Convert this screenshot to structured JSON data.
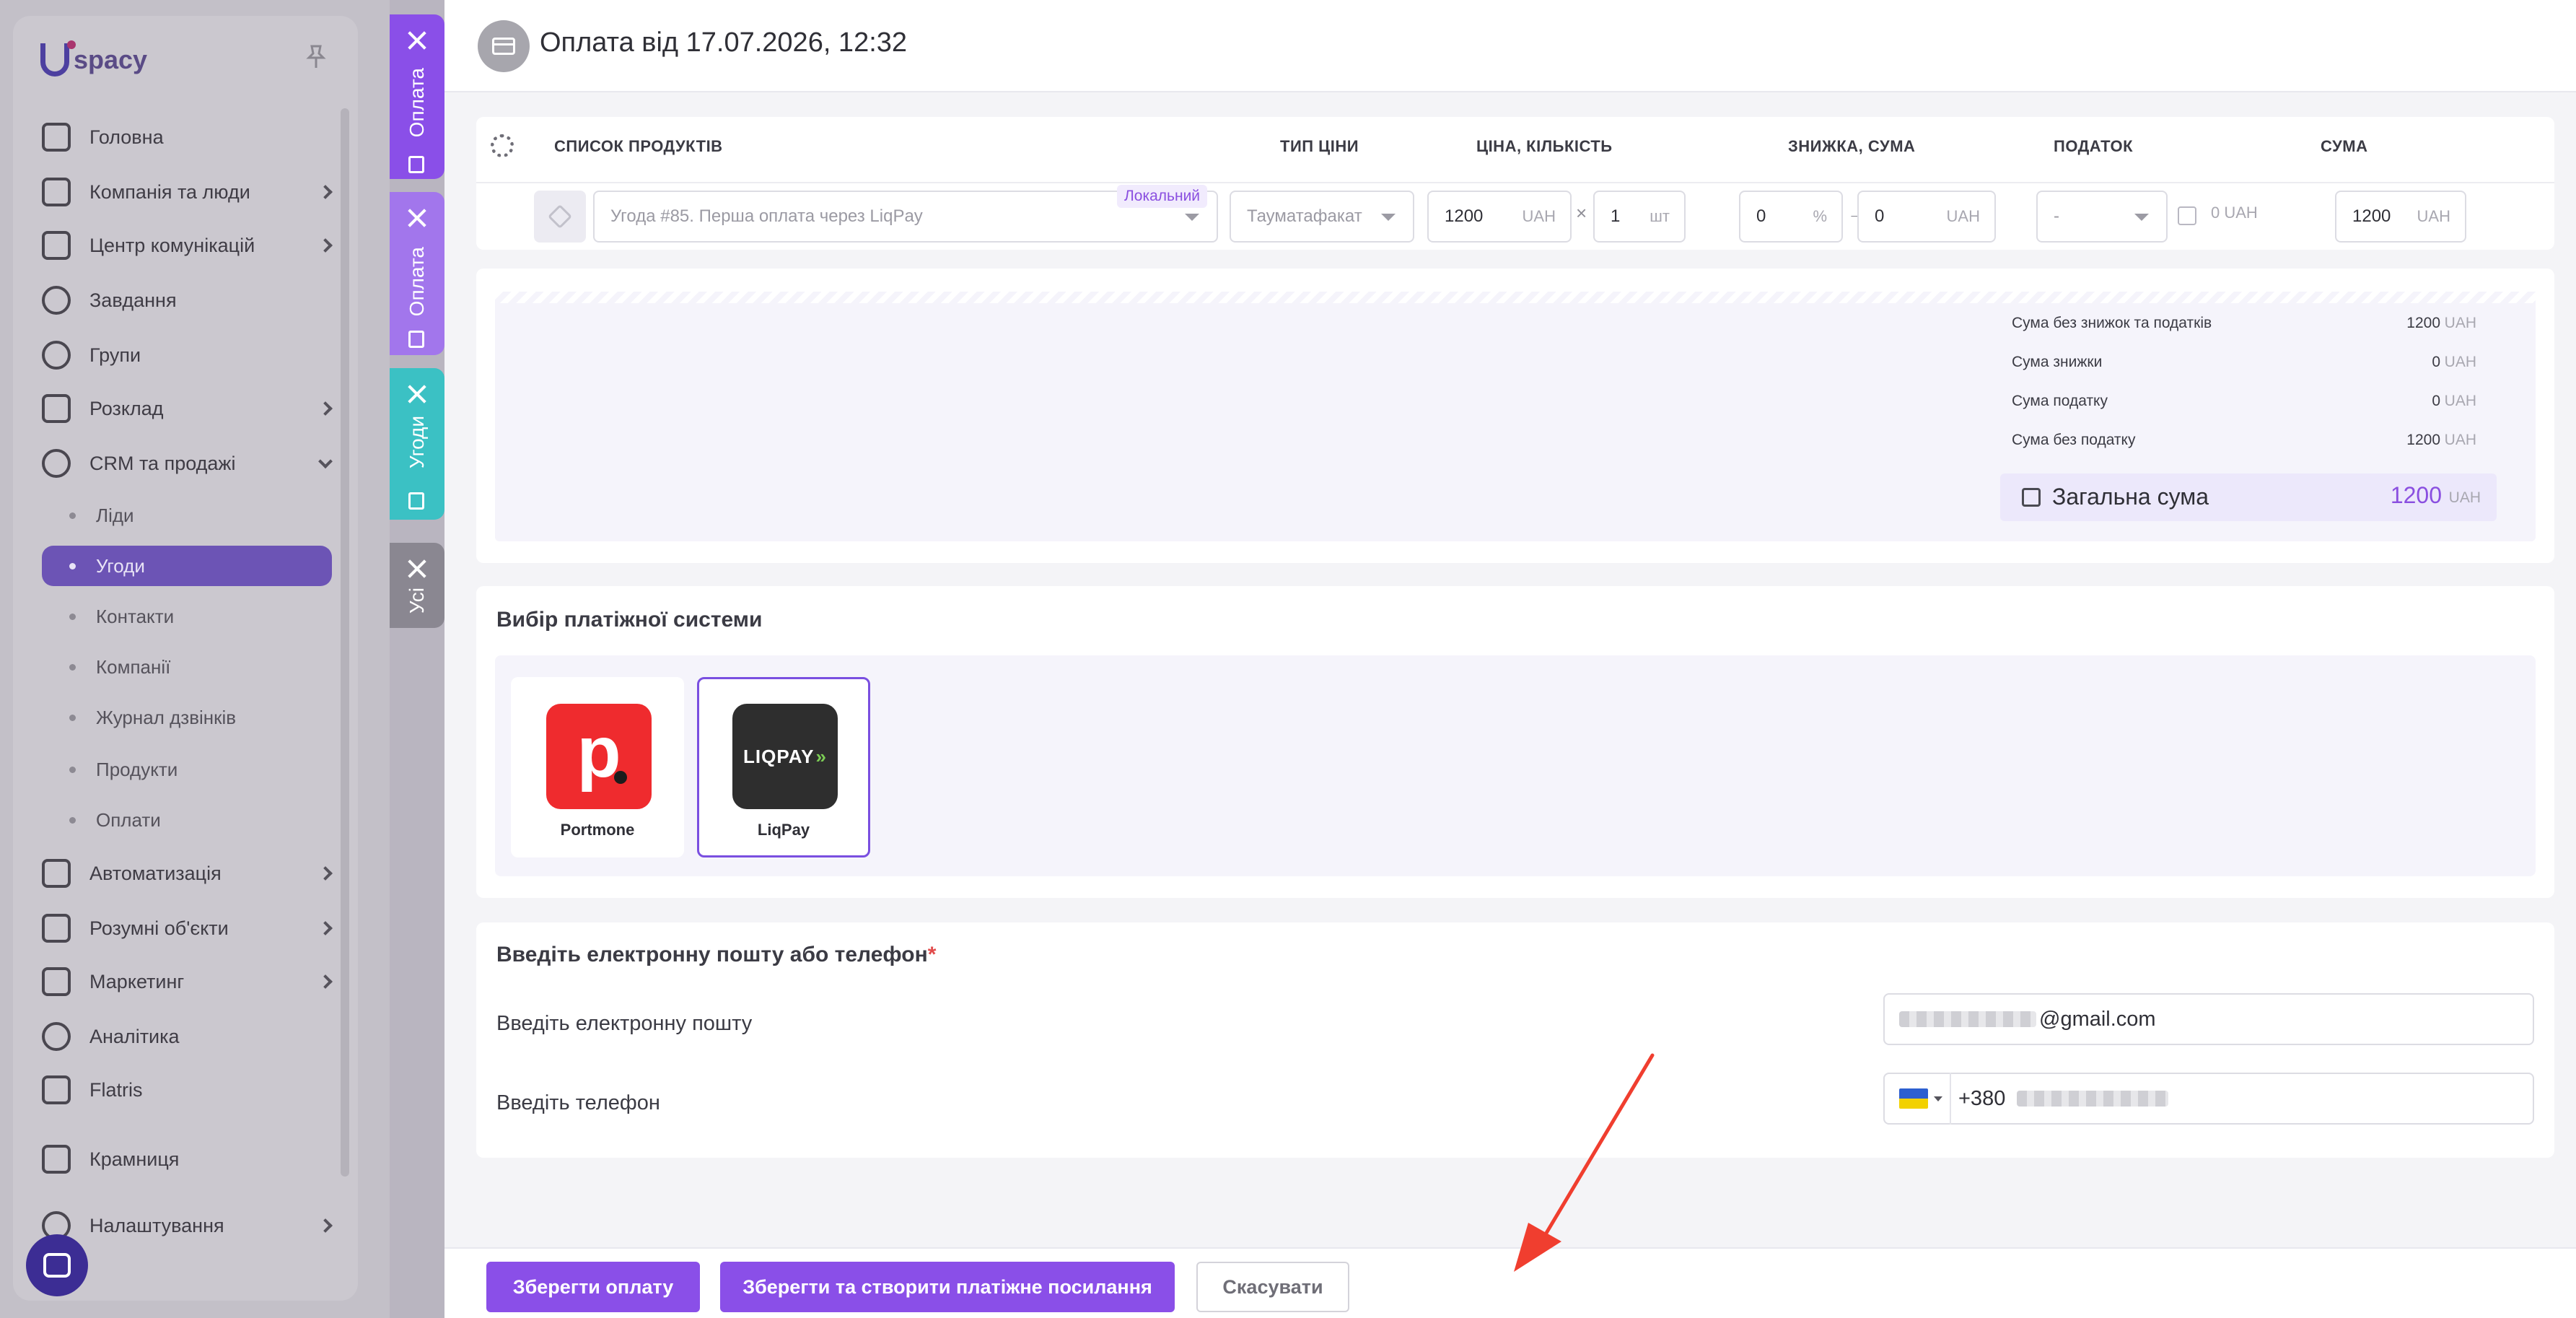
{
  "sidebar": {
    "logo": "spacy",
    "items": [
      {
        "label": "Головна",
        "icon": "home-icon"
      },
      {
        "label": "Компанія та люди",
        "icon": "building-icon"
      },
      {
        "label": "Центр комунікацій",
        "icon": "chat-edit-icon"
      },
      {
        "label": "Завдання",
        "icon": "check-circle-icon"
      },
      {
        "label": "Групи",
        "icon": "users-icon"
      },
      {
        "label": "Розклад",
        "icon": "calendar-icon"
      },
      {
        "label": "CRM та продажі",
        "icon": "database-icon"
      },
      {
        "label": "Автоматизація",
        "icon": "lightning-icon"
      },
      {
        "label": "Розумні об'єкти",
        "icon": "smart-object-icon"
      },
      {
        "label": "Маркетинг",
        "icon": "megaphone-icon"
      },
      {
        "label": "Аналітика",
        "icon": "chart-icon"
      },
      {
        "label": "Flatris",
        "icon": "blocks-icon"
      },
      {
        "label": "Крамниця",
        "icon": "store-icon"
      },
      {
        "label": "Налаштування",
        "icon": "gear-icon"
      }
    ],
    "crm_sub": [
      {
        "label": "Ліди"
      },
      {
        "label": "Угоди"
      },
      {
        "label": "Контакти"
      },
      {
        "label": "Компанії"
      },
      {
        "label": "Журнал дзвінків"
      },
      {
        "label": "Продукти"
      },
      {
        "label": "Оплати"
      }
    ]
  },
  "tabs": [
    {
      "label": "Оплата",
      "color": "#8a4fe8"
    },
    {
      "label": "Оплата",
      "color": "#8a4fe8"
    },
    {
      "label": "Угоди",
      "color": "#3bc1c4"
    },
    {
      "label": "Усі",
      "color": "#8a8791"
    }
  ],
  "header": {
    "title": "Оплата від 17.07.2026, 12:32"
  },
  "products": {
    "columns": {
      "product_list": "СПИСОК ПРОДУКТІВ",
      "price_type": "ТИП ЦІНИ",
      "price_qty": "ЦІНА, КІЛЬКІСТЬ",
      "discount_sum": "ЗНИЖКА, СУМА",
      "tax": "ПОДАТОК",
      "sum": "СУМА"
    },
    "row": {
      "product": "Угода #85. Перша оплата через LiqPay",
      "badge": "Локальний",
      "price_type": "Тауматафакат",
      "price": "1200",
      "price_unit": "UAH",
      "qty": "1",
      "qty_unit": "шт",
      "discount": "0",
      "discount_unit": "%",
      "discount_sum": "0",
      "discount_sum_unit": "UAH",
      "tax": "-",
      "tax_value": "0 UAH",
      "sum": "1200",
      "sum_unit": "UAH"
    }
  },
  "summary": {
    "rows": [
      {
        "label": "Сума без знижок та податків",
        "value": "1200",
        "unit": "UAH"
      },
      {
        "label": "Сума знижки",
        "value": "0",
        "unit": "UAH"
      },
      {
        "label": "Сума податку",
        "value": "0",
        "unit": "UAH"
      },
      {
        "label": "Сума без податку",
        "value": "1200",
        "unit": "UAH"
      }
    ],
    "total_label": "Загальна сума",
    "total_value": "1200",
    "total_unit": "UAH"
  },
  "payment": {
    "title": "Вибір платіжної системи",
    "options": [
      {
        "name": "Portmone",
        "logo_text": "p",
        "selected": false
      },
      {
        "name": "LiqPay",
        "logo_text": "LIQPAY",
        "logo_suffix": "»",
        "selected": true
      }
    ]
  },
  "contact": {
    "title": "Введіть електронну пошту або телефон",
    "required_mark": "*",
    "email_label": "Введіть електронну пошту",
    "email_value": "@gmail.com",
    "phone_label": "Введіть телефон",
    "phone_prefix": "+380"
  },
  "footer": {
    "save": "Зберегти оплату",
    "save_create_link": "Зберегти та створити платіжне посилання",
    "cancel": "Скасувати"
  },
  "colors": {
    "accent": "#8a4fe8",
    "arrow": "#f03e2f"
  }
}
